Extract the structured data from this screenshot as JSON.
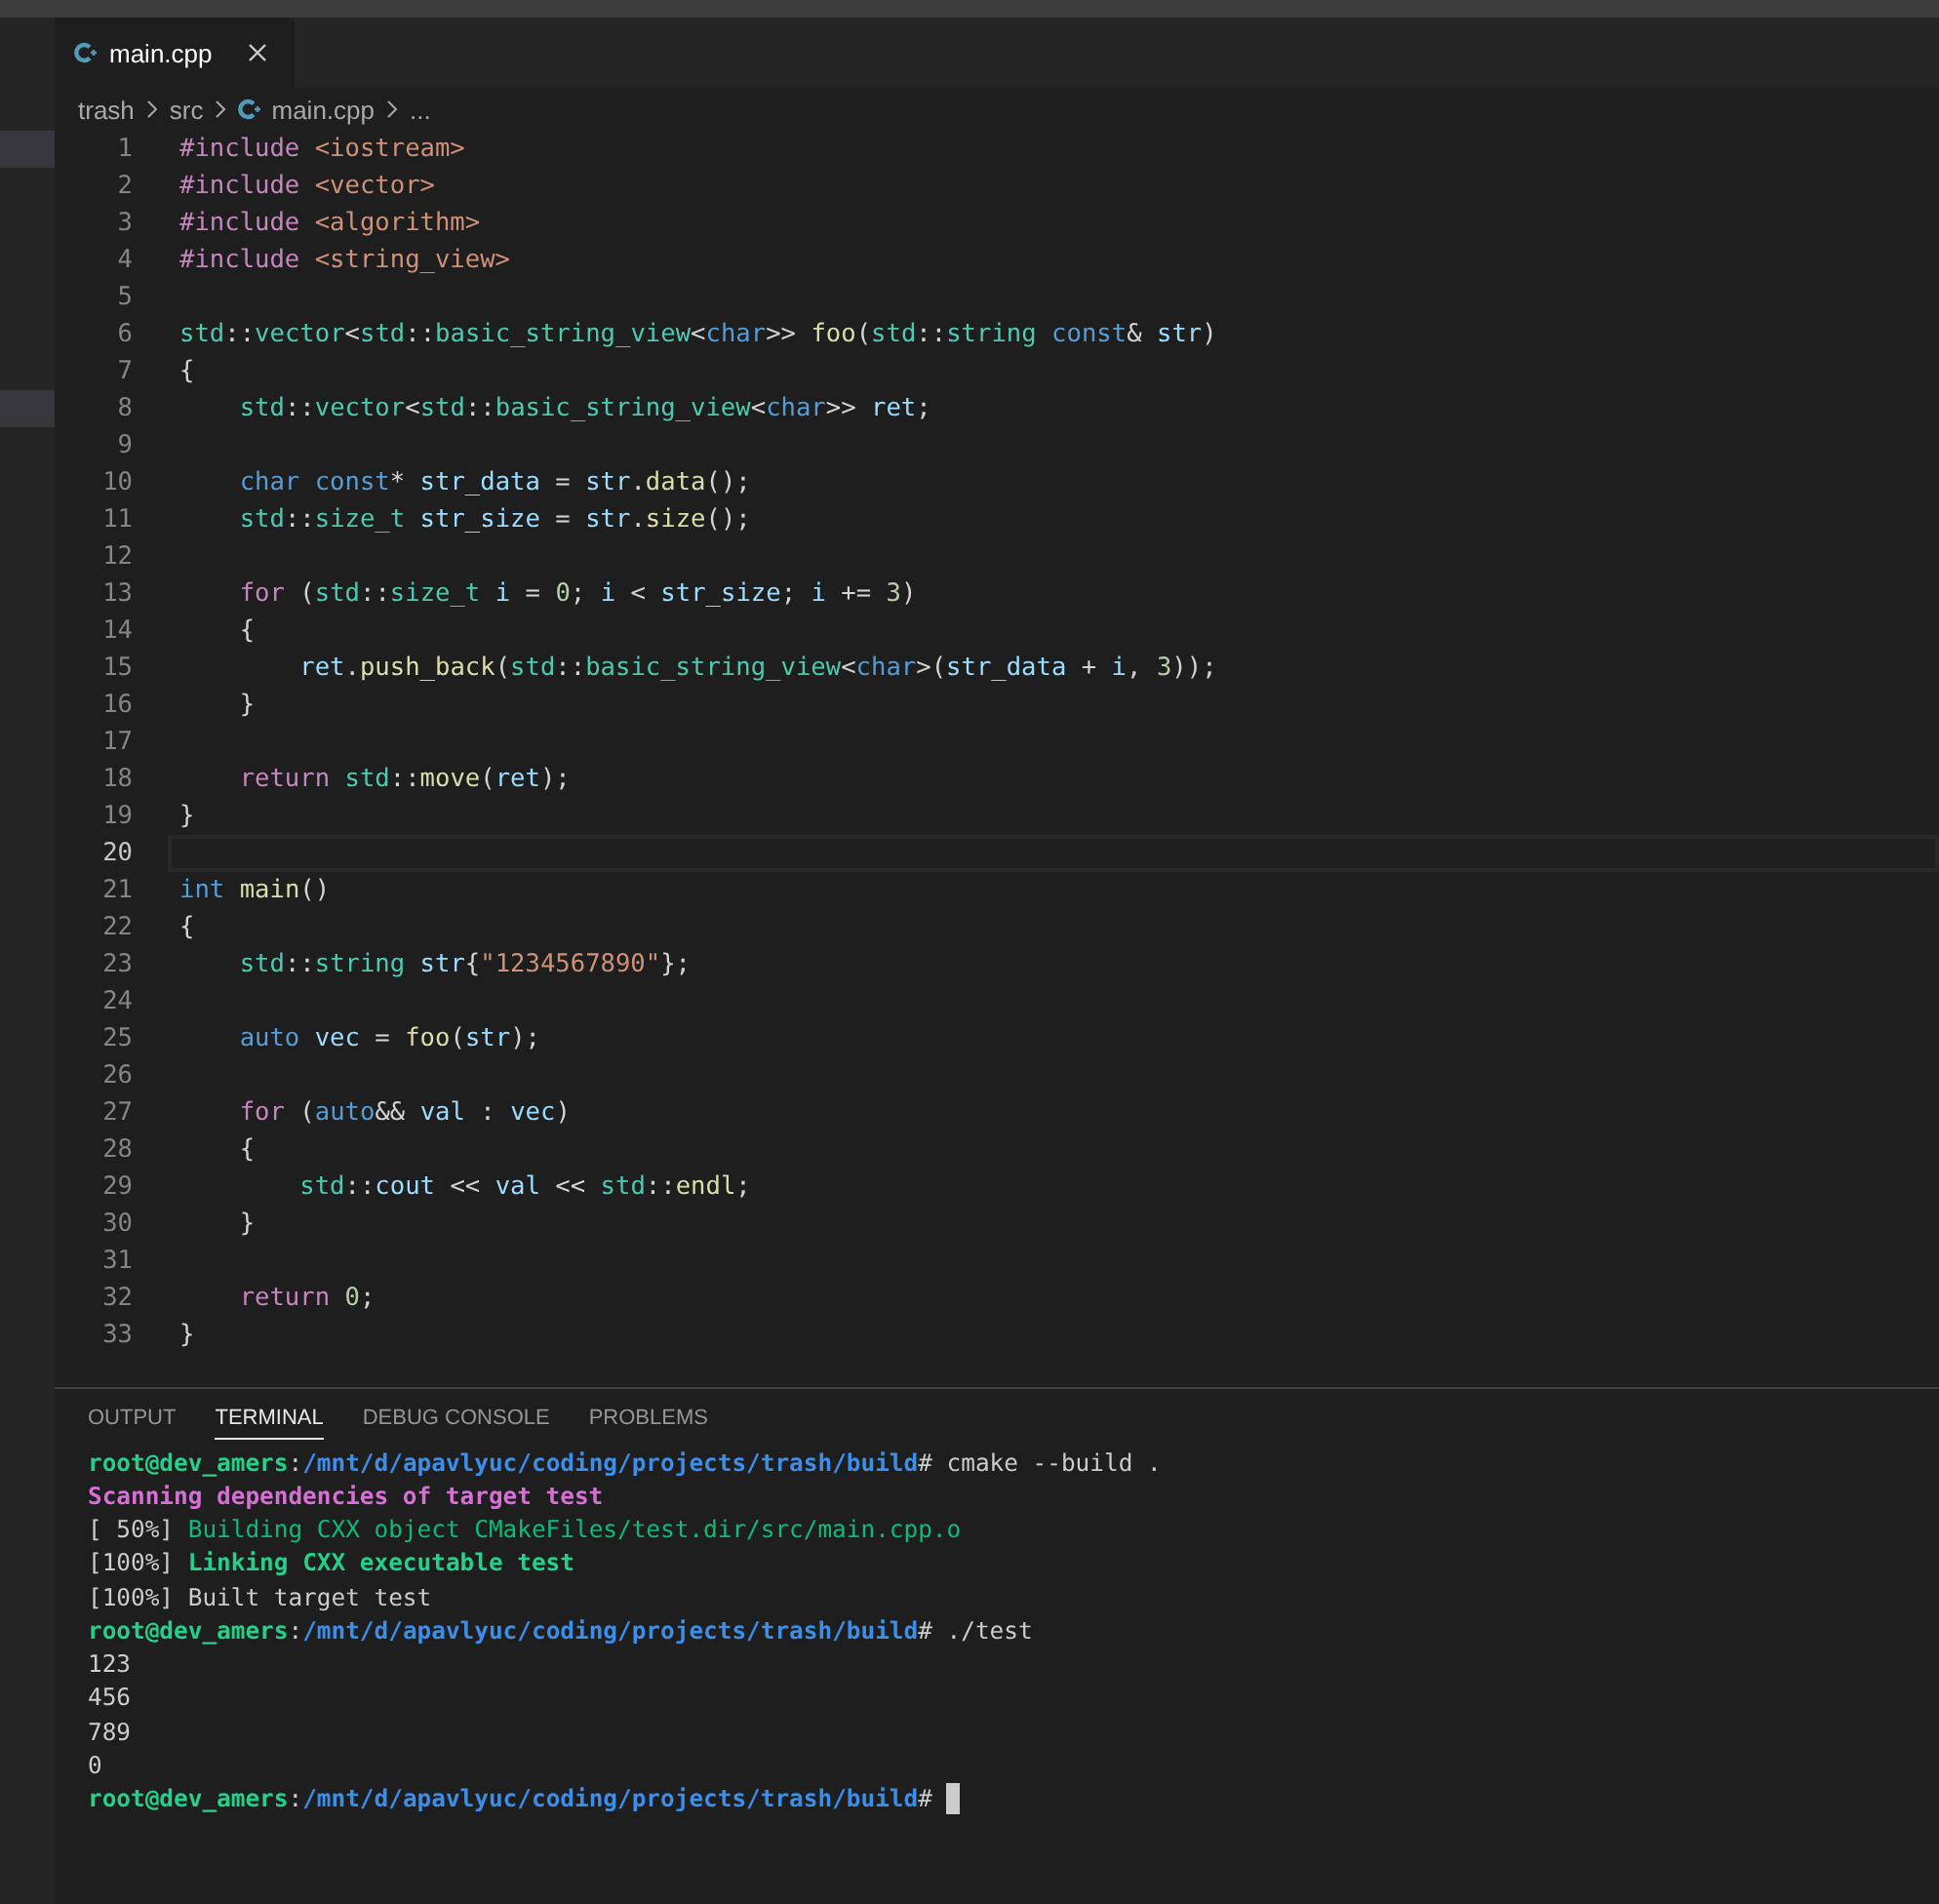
{
  "tab": {
    "label": "main.cpp",
    "selected": true
  },
  "breadcrumbs": [
    {
      "text": "trash",
      "kind": "folder"
    },
    {
      "text": "src",
      "kind": "folder"
    },
    {
      "text": "main.cpp",
      "kind": "file"
    },
    {
      "text": "...",
      "kind": "more"
    }
  ],
  "editor": {
    "lines": [
      {
        "number": "1",
        "current": false,
        "tokens": [
          {
            "text": "#include ",
            "kind": "control"
          },
          {
            "text": "<iostream>",
            "kind": "string"
          }
        ]
      },
      {
        "number": "2",
        "current": false,
        "tokens": [
          {
            "text": "#include ",
            "kind": "control"
          },
          {
            "text": "<vector>",
            "kind": "string"
          }
        ]
      },
      {
        "number": "3",
        "current": false,
        "tokens": [
          {
            "text": "#include ",
            "kind": "control"
          },
          {
            "text": "<algorithm>",
            "kind": "string"
          }
        ]
      },
      {
        "number": "4",
        "current": false,
        "tokens": [
          {
            "text": "#include ",
            "kind": "control"
          },
          {
            "text": "<string_view>",
            "kind": "string"
          }
        ]
      },
      {
        "number": "5",
        "current": false
      },
      {
        "number": "6",
        "current": false,
        "tokens": [
          {
            "text": "std",
            "kind": "type"
          },
          {
            "text": "::",
            "kind": "plain"
          },
          {
            "text": "vector",
            "kind": "type"
          },
          {
            "text": "<",
            "kind": "plain"
          },
          {
            "text": "std",
            "kind": "type"
          },
          {
            "text": "::",
            "kind": "plain"
          },
          {
            "text": "basic_string_view",
            "kind": "type"
          },
          {
            "text": "<",
            "kind": "plain"
          },
          {
            "text": "char",
            "kind": "keyword"
          },
          {
            "text": ">> ",
            "kind": "plain"
          },
          {
            "text": "foo",
            "kind": "func"
          },
          {
            "text": "(",
            "kind": "plain"
          },
          {
            "text": "std",
            "kind": "type"
          },
          {
            "text": "::",
            "kind": "plain"
          },
          {
            "text": "string ",
            "kind": "type"
          },
          {
            "text": "const",
            "kind": "keyword"
          },
          {
            "text": "& ",
            "kind": "plain"
          },
          {
            "text": "str",
            "kind": "var"
          },
          {
            "text": ")",
            "kind": "plain"
          }
        ]
      },
      {
        "number": "7",
        "current": false,
        "tokens": [
          {
            "text": "{",
            "kind": "plain"
          }
        ]
      },
      {
        "number": "8",
        "current": false,
        "tokens": [
          {
            "text": "    std",
            "kind": "type"
          },
          {
            "text": "::",
            "kind": "plain"
          },
          {
            "text": "vector",
            "kind": "type"
          },
          {
            "text": "<",
            "kind": "plain"
          },
          {
            "text": "std",
            "kind": "type"
          },
          {
            "text": "::",
            "kind": "plain"
          },
          {
            "text": "basic_string_view",
            "kind": "type"
          },
          {
            "text": "<",
            "kind": "plain"
          },
          {
            "text": "char",
            "kind": "keyword"
          },
          {
            "text": ">> ",
            "kind": "plain"
          },
          {
            "text": "ret",
            "kind": "var"
          },
          {
            "text": ";",
            "kind": "plain"
          }
        ]
      },
      {
        "number": "9",
        "current": false
      },
      {
        "number": "10",
        "current": false,
        "tokens": [
          {
            "text": "    char const",
            "kind": "keyword"
          },
          {
            "text": "* ",
            "kind": "plain"
          },
          {
            "text": "str_data",
            "kind": "var"
          },
          {
            "text": " = ",
            "kind": "plain"
          },
          {
            "text": "str",
            "kind": "var"
          },
          {
            "text": ".",
            "kind": "plain"
          },
          {
            "text": "data",
            "kind": "func"
          },
          {
            "text": "();",
            "kind": "plain"
          }
        ]
      },
      {
        "number": "11",
        "current": false,
        "tokens": [
          {
            "text": "    std",
            "kind": "type"
          },
          {
            "text": "::",
            "kind": "plain"
          },
          {
            "text": "size_t ",
            "kind": "type"
          },
          {
            "text": "str_size",
            "kind": "var"
          },
          {
            "text": " = ",
            "kind": "plain"
          },
          {
            "text": "str",
            "kind": "var"
          },
          {
            "text": ".",
            "kind": "plain"
          },
          {
            "text": "size",
            "kind": "func"
          },
          {
            "text": "();",
            "kind": "plain"
          }
        ]
      },
      {
        "number": "12",
        "current": false
      },
      {
        "number": "13",
        "current": false,
        "tokens": [
          {
            "text": "    for",
            "kind": "control"
          },
          {
            "text": " (",
            "kind": "plain"
          },
          {
            "text": "std",
            "kind": "type"
          },
          {
            "text": "::",
            "kind": "plain"
          },
          {
            "text": "size_t ",
            "kind": "type"
          },
          {
            "text": "i",
            "kind": "var"
          },
          {
            "text": " = ",
            "kind": "plain"
          },
          {
            "text": "0",
            "kind": "number"
          },
          {
            "text": "; ",
            "kind": "plain"
          },
          {
            "text": "i",
            "kind": "var"
          },
          {
            "text": " < ",
            "kind": "plain"
          },
          {
            "text": "str_size",
            "kind": "var"
          },
          {
            "text": "; ",
            "kind": "plain"
          },
          {
            "text": "i",
            "kind": "var"
          },
          {
            "text": " += ",
            "kind": "plain"
          },
          {
            "text": "3",
            "kind": "number"
          },
          {
            "text": ")",
            "kind": "plain"
          }
        ]
      },
      {
        "number": "14",
        "current": false,
        "tokens": [
          {
            "text": "    {",
            "kind": "plain"
          }
        ]
      },
      {
        "number": "15",
        "current": false,
        "tokens": [
          {
            "text": "        ret",
            "kind": "var"
          },
          {
            "text": ".",
            "kind": "plain"
          },
          {
            "text": "push_back",
            "kind": "func"
          },
          {
            "text": "(",
            "kind": "plain"
          },
          {
            "text": "std",
            "kind": "type"
          },
          {
            "text": "::",
            "kind": "plain"
          },
          {
            "text": "basic_string_view",
            "kind": "type"
          },
          {
            "text": "<",
            "kind": "plain"
          },
          {
            "text": "char",
            "kind": "keyword"
          },
          {
            "text": ">(",
            "kind": "plain"
          },
          {
            "text": "str_data",
            "kind": "var"
          },
          {
            "text": " + ",
            "kind": "plain"
          },
          {
            "text": "i",
            "kind": "var"
          },
          {
            "text": ", ",
            "kind": "plain"
          },
          {
            "text": "3",
            "kind": "number"
          },
          {
            "text": "));",
            "kind": "plain"
          }
        ]
      },
      {
        "number": "16",
        "current": false,
        "tokens": [
          {
            "text": "    }",
            "kind": "plain"
          }
        ]
      },
      {
        "number": "17",
        "current": false
      },
      {
        "number": "18",
        "current": false,
        "tokens": [
          {
            "text": "    return ",
            "kind": "control"
          },
          {
            "text": "std",
            "kind": "type"
          },
          {
            "text": "::",
            "kind": "plain"
          },
          {
            "text": "move",
            "kind": "func"
          },
          {
            "text": "(",
            "kind": "plain"
          },
          {
            "text": "ret",
            "kind": "var"
          },
          {
            "text": ");",
            "kind": "plain"
          }
        ]
      },
      {
        "number": "19",
        "current": false,
        "tokens": [
          {
            "text": "}",
            "kind": "plain"
          }
        ]
      },
      {
        "number": "20",
        "current": true
      },
      {
        "number": "21",
        "current": false,
        "tokens": [
          {
            "text": "int ",
            "kind": "keyword"
          },
          {
            "text": "main",
            "kind": "func"
          },
          {
            "text": "()",
            "kind": "plain"
          }
        ]
      },
      {
        "number": "22",
        "current": false,
        "tokens": [
          {
            "text": "{",
            "kind": "plain"
          }
        ]
      },
      {
        "number": "23",
        "current": false,
        "tokens": [
          {
            "text": "    std",
            "kind": "type"
          },
          {
            "text": "::",
            "kind": "plain"
          },
          {
            "text": "string ",
            "kind": "type"
          },
          {
            "text": "str",
            "kind": "var"
          },
          {
            "text": "{",
            "kind": "plain"
          },
          {
            "text": "\"1234567890\"",
            "kind": "string"
          },
          {
            "text": "};",
            "kind": "plain"
          }
        ]
      },
      {
        "number": "24",
        "current": false
      },
      {
        "number": "25",
        "current": false,
        "tokens": [
          {
            "text": "    auto ",
            "kind": "keyword"
          },
          {
            "text": "vec",
            "kind": "var"
          },
          {
            "text": " = ",
            "kind": "plain"
          },
          {
            "text": "foo",
            "kind": "func"
          },
          {
            "text": "(",
            "kind": "plain"
          },
          {
            "text": "str",
            "kind": "var"
          },
          {
            "text": ");",
            "kind": "plain"
          }
        ]
      },
      {
        "number": "26",
        "current": false
      },
      {
        "number": "27",
        "current": false,
        "tokens": [
          {
            "text": "    for",
            "kind": "control"
          },
          {
            "text": " (",
            "kind": "plain"
          },
          {
            "text": "auto",
            "kind": "keyword"
          },
          {
            "text": "&& ",
            "kind": "plain"
          },
          {
            "text": "val",
            "kind": "var"
          },
          {
            "text": " : ",
            "kind": "plain"
          },
          {
            "text": "vec",
            "kind": "var"
          },
          {
            "text": ")",
            "kind": "plain"
          }
        ]
      },
      {
        "number": "28",
        "current": false,
        "tokens": [
          {
            "text": "    {",
            "kind": "plain"
          }
        ]
      },
      {
        "number": "29",
        "current": false,
        "tokens": [
          {
            "text": "        std",
            "kind": "type"
          },
          {
            "text": "::",
            "kind": "plain"
          },
          {
            "text": "cout",
            "kind": "var"
          },
          {
            "text": " << ",
            "kind": "plain"
          },
          {
            "text": "val",
            "kind": "var"
          },
          {
            "text": " << ",
            "kind": "plain"
          },
          {
            "text": "std",
            "kind": "type"
          },
          {
            "text": "::",
            "kind": "plain"
          },
          {
            "text": "endl",
            "kind": "func"
          },
          {
            "text": ";",
            "kind": "plain"
          }
        ]
      },
      {
        "number": "30",
        "current": false,
        "tokens": [
          {
            "text": "    }",
            "kind": "plain"
          }
        ]
      },
      {
        "number": "31",
        "current": false
      },
      {
        "number": "32",
        "current": false,
        "tokens": [
          {
            "text": "    return ",
            "kind": "control"
          },
          {
            "text": "0",
            "kind": "number"
          },
          {
            "text": ";",
            "kind": "plain"
          }
        ]
      },
      {
        "number": "33",
        "current": false,
        "tokens": [
          {
            "text": "}",
            "kind": "plain"
          }
        ]
      }
    ]
  },
  "panel_tabs": [
    {
      "label": "OUTPUT",
      "selected": false
    },
    {
      "label": "TERMINAL",
      "selected": true
    },
    {
      "label": "DEBUG CONSOLE",
      "selected": false
    },
    {
      "label": "PROBLEMS",
      "selected": false
    }
  ],
  "terminal": {
    "cursor": true,
    "lines": [
      {
        "tokens": [
          {
            "text": "root@dev_amers",
            "kind": "user"
          },
          {
            "text": ":",
            "kind": "plain"
          },
          {
            "text": "/mnt/d/apavlyuc/coding/projects/trash/build",
            "kind": "path"
          },
          {
            "text": "# cmake --build .",
            "kind": "plain"
          }
        ]
      },
      {
        "tokens": [
          {
            "text": "Scanning dependencies of target test",
            "kind": "magenta"
          }
        ]
      },
      {
        "tokens": [
          {
            "text": "[ 50%] ",
            "kind": "plain"
          },
          {
            "text": "Building CXX object CMakeFiles/test.dir/src/main.cpp.o",
            "kind": "green"
          }
        ]
      },
      {
        "tokens": [
          {
            "text": "[100%] ",
            "kind": "plain"
          },
          {
            "text": "Linking CXX executable test",
            "kind": "greenbold"
          }
        ]
      },
      {
        "tokens": [
          {
            "text": "[100%] Built target test",
            "kind": "plain"
          }
        ]
      },
      {
        "tokens": [
          {
            "text": "root@dev_amers",
            "kind": "user"
          },
          {
            "text": ":",
            "kind": "plain"
          },
          {
            "text": "/mnt/d/apavlyuc/coding/projects/trash/build",
            "kind": "path"
          },
          {
            "text": "# ./test",
            "kind": "plain"
          }
        ]
      },
      {
        "tokens": [
          {
            "text": "123",
            "kind": "plain"
          }
        ]
      },
      {
        "tokens": [
          {
            "text": "456",
            "kind": "plain"
          }
        ]
      },
      {
        "tokens": [
          {
            "text": "789",
            "kind": "plain"
          }
        ]
      },
      {
        "tokens": [
          {
            "text": "0",
            "kind": "plain"
          }
        ]
      },
      {
        "tokens": [
          {
            "text": "root@dev_amers",
            "kind": "user"
          },
          {
            "text": ":",
            "kind": "plain"
          },
          {
            "text": "/mnt/d/apavlyuc/coding/projects/trash/build",
            "kind": "path"
          },
          {
            "text": "#",
            "kind": "plain"
          }
        ]
      }
    ]
  }
}
